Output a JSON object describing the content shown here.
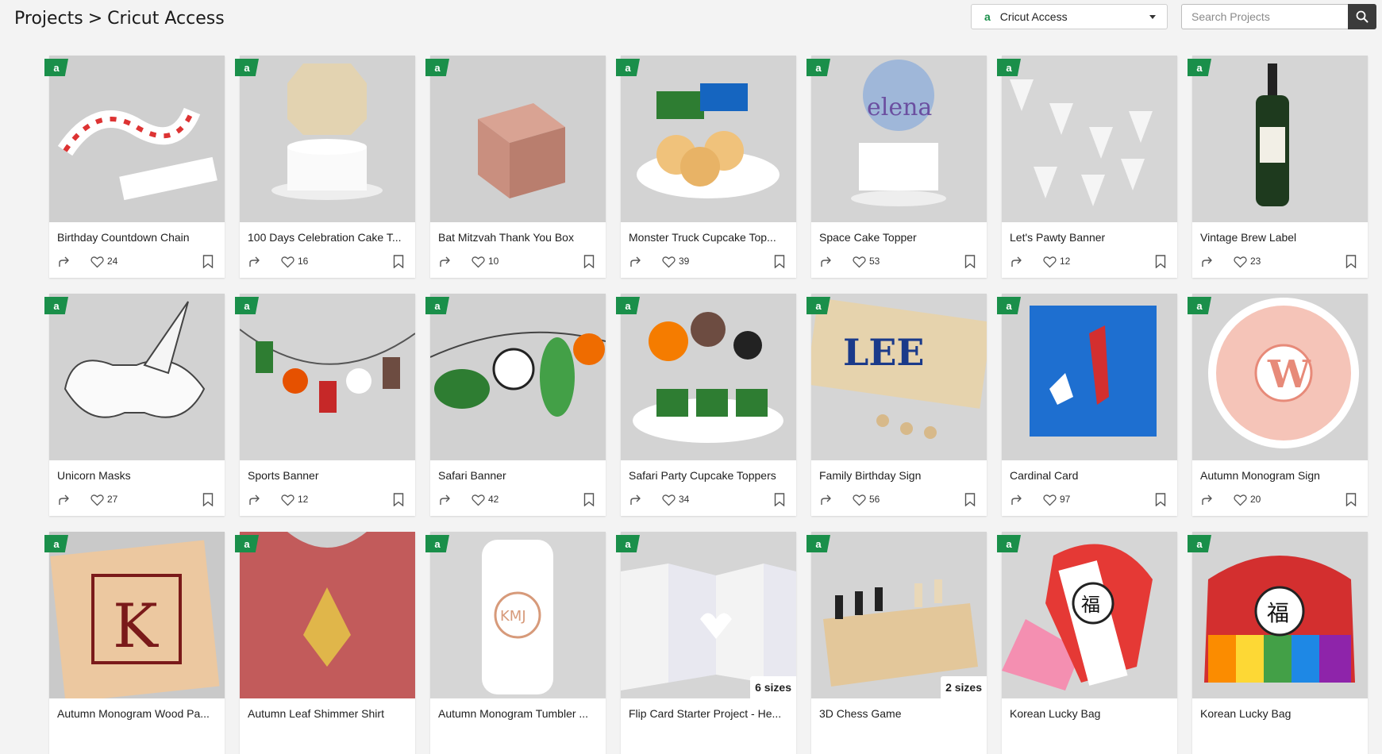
{
  "breadcrumb": {
    "root": "Projects",
    "separator": ">",
    "current": "Cricut Access"
  },
  "filter": {
    "icon": "cricut-access-icon",
    "selected": "Cricut Access",
    "mark": "a"
  },
  "search": {
    "placeholder": "Search Projects",
    "value": "",
    "button_icon": "search-icon"
  },
  "colors": {
    "access_green": "#1a8f4a",
    "search_button": "#3b3b3b",
    "background": "#f3f3f3"
  },
  "projects": [
    {
      "title": "Birthday Countdown Chain",
      "likes": "24",
      "sizes": "",
      "badge": "a"
    },
    {
      "title": "100 Days Celebration Cake T...",
      "likes": "16",
      "sizes": "",
      "badge": "a"
    },
    {
      "title": "Bat Mitzvah Thank You Box",
      "likes": "10",
      "sizes": "",
      "badge": "a"
    },
    {
      "title": "Monster Truck Cupcake Top...",
      "likes": "39",
      "sizes": "",
      "badge": "a"
    },
    {
      "title": "Space Cake Topper",
      "likes": "53",
      "sizes": "",
      "badge": "a"
    },
    {
      "title": "Let's Pawty Banner",
      "likes": "12",
      "sizes": "",
      "badge": "a"
    },
    {
      "title": "Vintage Brew Label",
      "likes": "23",
      "sizes": "",
      "badge": "a"
    },
    {
      "title": "Unicorn Masks",
      "likes": "27",
      "sizes": "",
      "badge": "a"
    },
    {
      "title": "Sports Banner",
      "likes": "12",
      "sizes": "",
      "badge": "a"
    },
    {
      "title": "Safari Banner",
      "likes": "42",
      "sizes": "",
      "badge": "a"
    },
    {
      "title": "Safari Party Cupcake Toppers",
      "likes": "34",
      "sizes": "",
      "badge": "a"
    },
    {
      "title": "Family Birthday Sign",
      "likes": "56",
      "sizes": "",
      "badge": "a"
    },
    {
      "title": "Cardinal Card",
      "likes": "97",
      "sizes": "",
      "badge": "a"
    },
    {
      "title": "Autumn Monogram Sign",
      "likes": "20",
      "sizes": "",
      "badge": "a"
    },
    {
      "title": "Autumn Monogram Wood Pa...",
      "likes": "",
      "sizes": "",
      "badge": "a"
    },
    {
      "title": "Autumn Leaf Shimmer Shirt",
      "likes": "",
      "sizes": "",
      "badge": "a"
    },
    {
      "title": "Autumn Monogram Tumbler ...",
      "likes": "",
      "sizes": "",
      "badge": "a"
    },
    {
      "title": "Flip Card Starter Project - He...",
      "likes": "",
      "sizes": "6 sizes",
      "badge": "a"
    },
    {
      "title": "3D Chess Game",
      "likes": "",
      "sizes": "2 sizes",
      "badge": "a"
    },
    {
      "title": "Korean Lucky Bag",
      "likes": "",
      "sizes": "",
      "badge": "a"
    },
    {
      "title": "Korean Lucky Bag",
      "likes": "",
      "sizes": "",
      "badge": "a"
    }
  ]
}
